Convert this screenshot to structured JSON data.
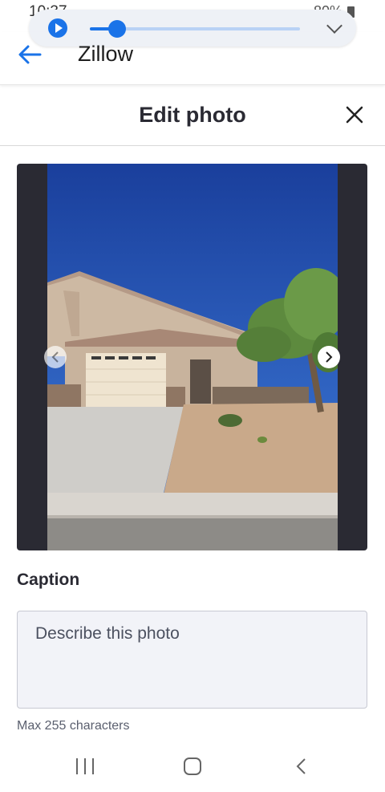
{
  "status_bar": {
    "time": "10:37",
    "battery": "80%"
  },
  "media": {
    "progress": 0.13
  },
  "app_bar": {
    "title": "Zillow"
  },
  "dialog": {
    "title": "Edit photo"
  },
  "photo_viewer": {
    "photo_description_icon": "house-photo"
  },
  "caption": {
    "label": "Caption",
    "placeholder": "Describe this photo",
    "value": "",
    "hint": "Max 255 characters"
  },
  "colors": {
    "accent": "#1a73e8",
    "title_text": "#2a2a33",
    "frame_bg": "#2a2a33",
    "input_bg": "#f2f3f8"
  }
}
